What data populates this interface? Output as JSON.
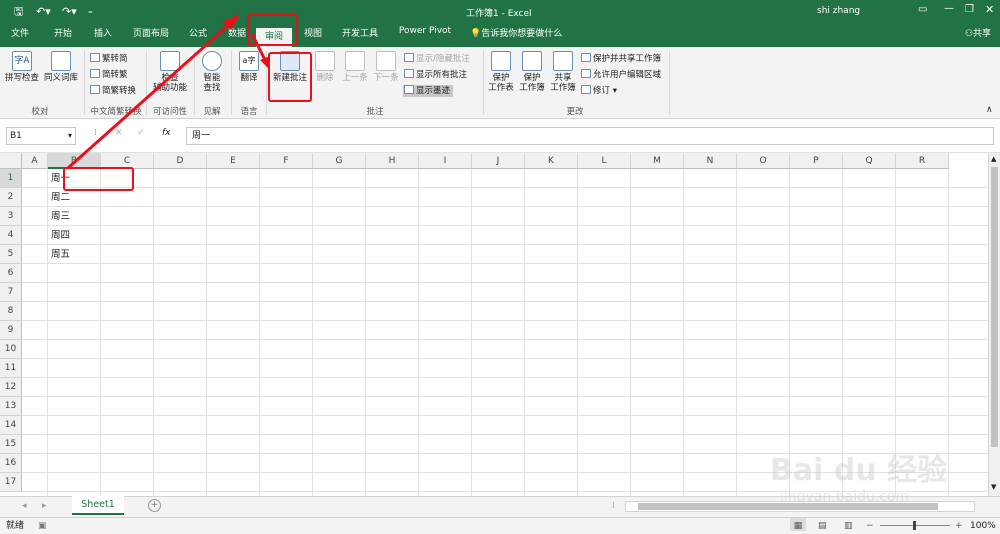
{
  "window": {
    "title": "工作簿1  -  Excel",
    "user": "shi zhang",
    "share_label": "共享"
  },
  "menu": {
    "tabs": [
      {
        "label": "文件"
      },
      {
        "label": "开始"
      },
      {
        "label": "插入"
      },
      {
        "label": "页面布局"
      },
      {
        "label": "公式"
      },
      {
        "label": "数据"
      },
      {
        "label": "审阅"
      },
      {
        "label": "视图"
      },
      {
        "label": "开发工具"
      },
      {
        "label": "Power Pivot"
      }
    ],
    "active_tab": "审阅",
    "tell_me": "告诉我你想要做什么"
  },
  "ribbon": {
    "proofing": {
      "spell": "拼写检查",
      "thesaurus": "同义词库",
      "label": "校对"
    },
    "chinese": {
      "t2s": "繁转简",
      "s2t": "简转繁",
      "convert": "简繁转换",
      "label": "中文简繁转换"
    },
    "accessibility": {
      "check_line1": "检查",
      "check_line2": "辅助功能",
      "label": "可访问性"
    },
    "insights": {
      "smart_line1": "智能",
      "smart_line2": "查找",
      "label": "见解"
    },
    "language": {
      "translate": "翻译",
      "label": "语言"
    },
    "comments": {
      "new": "新建批注",
      "delete": "删除",
      "prev": "上一条",
      "next": "下一条",
      "show_hide": "显示/隐藏批注",
      "show_all": "显示所有批注",
      "show_ink": "显示墨迹",
      "label": "批注"
    },
    "changes": {
      "protect_sheet_l1": "保护",
      "protect_sheet_l2": "工作表",
      "protect_wb_l1": "保护",
      "protect_wb_l2": "工作簿",
      "share_wb_l1": "共享",
      "share_wb_l2": "工作簿",
      "protect_share": "保护并共享工作簿",
      "allow_edit": "允许用户编辑区域",
      "track": "修订",
      "label": "更改"
    }
  },
  "formula_bar": {
    "name_box": "B1",
    "fx": "fx",
    "content": "周一"
  },
  "sheet": {
    "columns": [
      "A",
      "B",
      "C",
      "D",
      "E",
      "F",
      "G",
      "H",
      "I",
      "J",
      "K",
      "L",
      "M",
      "N",
      "O",
      "P",
      "Q",
      "R"
    ],
    "rows": [
      "1",
      "2",
      "3",
      "4",
      "5",
      "6",
      "7",
      "8",
      "9",
      "10",
      "11",
      "12",
      "13",
      "14",
      "15",
      "16",
      "17"
    ],
    "b_values": [
      "周一",
      "周二",
      "周三",
      "周四",
      "周五"
    ]
  },
  "sheet_tabs": {
    "active": "Sheet1"
  },
  "status": {
    "ready": "就绪",
    "zoom": "100%"
  },
  "colors": {
    "accent": "#217346",
    "highlight": "#e8101a"
  },
  "watermark": {
    "text1": "Bai du 经验",
    "text2": "jingyan.baidu.com"
  }
}
